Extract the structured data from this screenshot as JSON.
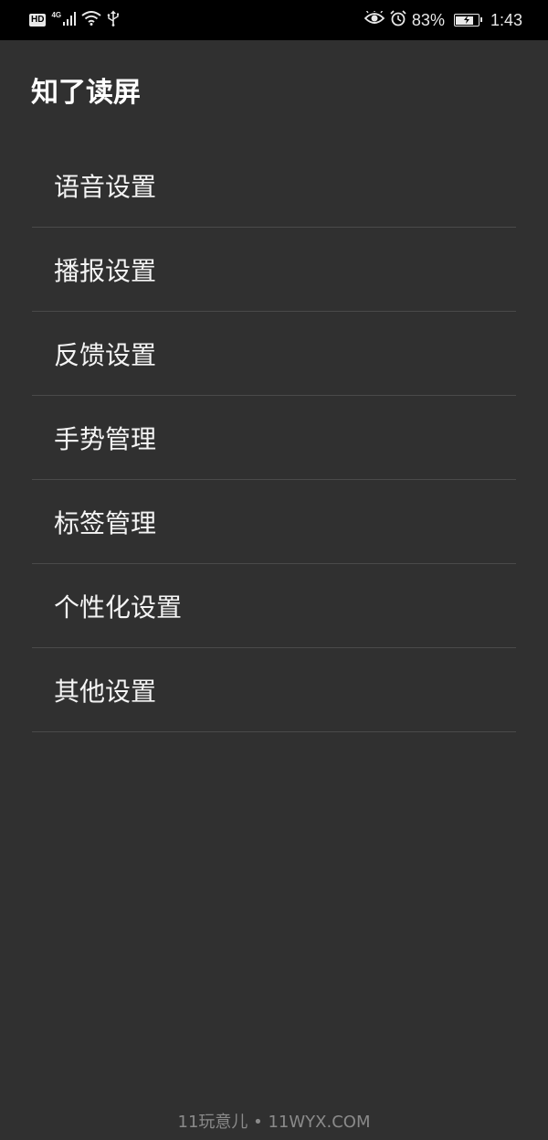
{
  "status_bar": {
    "hd_label": "HD",
    "network_label": "4G",
    "battery_text": "83%",
    "battery_level": 0.83,
    "time": "1:43",
    "icons": [
      "signal-icon",
      "wifi-icon",
      "usb-icon",
      "eye-comfort-icon",
      "alarm-icon",
      "battery-charging-icon"
    ]
  },
  "app": {
    "title": "知了读屏"
  },
  "menu": {
    "items": [
      {
        "label": "语音设置"
      },
      {
        "label": "播报设置"
      },
      {
        "label": "反馈设置"
      },
      {
        "label": "手势管理"
      },
      {
        "label": "标签管理"
      },
      {
        "label": "个性化设置"
      },
      {
        "label": "其他设置"
      }
    ]
  },
  "watermark": {
    "text": "11玩意儿 • 11WYX.COM"
  },
  "colors": {
    "background": "#303030",
    "status_bar": "#000000",
    "divider": "#4a4a4a",
    "text": "#ffffff",
    "watermark": "#8a8a8a"
  }
}
